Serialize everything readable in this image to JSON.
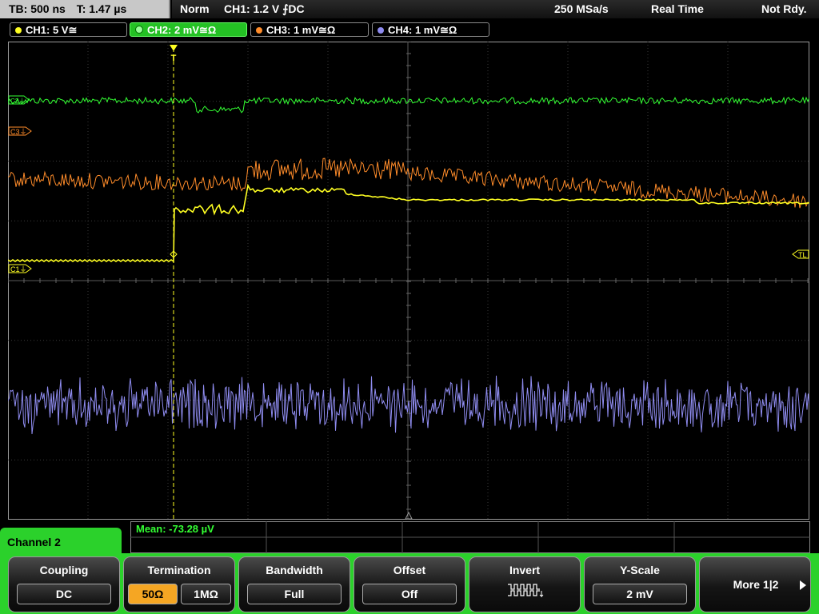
{
  "status": {
    "timebase": "TB: 500 ns",
    "trigger_time": "T: 1.47 µs",
    "mode": "Norm",
    "trigger_setting": "CH1: 1.2 V ⨍DC",
    "sample_rate": "250 MSa/s",
    "acquisition": "Real Time",
    "ready_state": "Not Rdy."
  },
  "channels": [
    {
      "label": "CH1: 5 V≅",
      "color": "#ffff22"
    },
    {
      "label": "CH2: 2 mV≅Ω",
      "color": "#33ff33"
    },
    {
      "label": "CH3: 1 mV≅Ω",
      "color": "#ff8c2a"
    },
    {
      "label": "CH4: 1 mV≅Ω",
      "color": "#8f8cf0"
    }
  ],
  "markers": {
    "c2": "C2⏚",
    "c3": "C3⏚",
    "c1": "C1⏚",
    "trigger_level": "TL",
    "trigger_pos": "T"
  },
  "measurement": {
    "mean": "Mean: -73.28 µV"
  },
  "menu": {
    "title": "Channel 2",
    "coupling": {
      "label": "Coupling",
      "value": "DC"
    },
    "termination": {
      "label": "Termination",
      "opt1": "50Ω",
      "opt2": "1MΩ"
    },
    "bandwidth": {
      "label": "Bandwidth",
      "value": "Full"
    },
    "offset": {
      "label": "Offset",
      "value": "Off"
    },
    "invert": {
      "label": "Invert"
    },
    "yscale": {
      "label": "Y-Scale",
      "value": "2 mV"
    },
    "more": {
      "label": "More 1|2"
    }
  },
  "colors": {
    "ch1": "#ffff22",
    "ch2": "#33ff33",
    "ch3": "#ff8c2a",
    "ch4": "#8f8cf0",
    "accent": "#2bd12b",
    "selected": "#f5a623"
  }
}
